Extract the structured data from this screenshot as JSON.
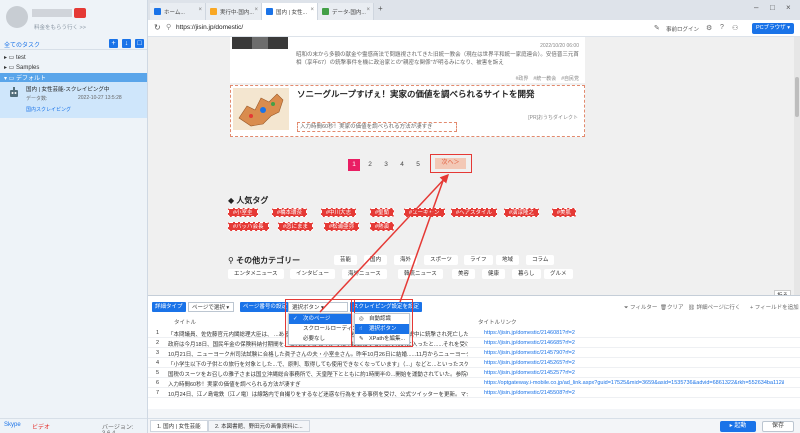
{
  "sidebar": {
    "user_sub": "料金をもらう行く >>",
    "all_tasks": "全てのタスク",
    "tree": [
      {
        "label": "test"
      },
      {
        "label": "Samples"
      },
      {
        "label": "デフォルト"
      }
    ],
    "task": {
      "title": "国内 | 女性芸能-スクレイピング中",
      "data_label": "データ数:",
      "date": "2022-10-27 13:5:28",
      "status": "国内スクレイピング"
    },
    "bottom": {
      "skype": "Skype",
      "video": "ビデオ",
      "version": "バージョン: 3.6.4"
    }
  },
  "browser": {
    "tabs": [
      {
        "label": "ホーム..."
      },
      {
        "label": "実行中-国内..."
      },
      {
        "label": "国内 | 女性..."
      },
      {
        "label": "データ-国内..."
      }
    ],
    "new_tab": "+",
    "url": "https://jisin.jp/domestic/",
    "login": "事前ログイン",
    "pc_browser": "PCブラウザ"
  },
  "web": {
    "article1": {
      "meta": "2022/10/20 06:00",
      "body": "昭和の末から多額の献金や霊感商法で問題視されてきた旧統一教会（現在は世界平和統一家庭連合）。安倍晋三元首相（享年67）の銃撃事件を機に政治家との\"親密な関係\"が明るみになり、被害を訴え",
      "tags": "#政界　#統一教会　#自民党"
    },
    "article2": {
      "title": "ソニーグループすげぇ！実家の価値を調べられるサイトを開発",
      "meta": "[PR]おうちダイレクト",
      "body": "入力時間60秒！実家の価値を調べられる方法が凄すぎ"
    },
    "pager": [
      "1",
      "2",
      "3",
      "4",
      "5"
    ],
    "next": "次へ＞",
    "popular_tags_title": "人気タグ",
    "tags": [
      "#小室圭",
      "#橋本環奈",
      "#中川大志",
      "#聖蘭",
      "#ユーキャン",
      "#ヘアスタイル",
      "#演淳隆之",
      "#美肌",
      "#バッハ会長",
      "#恋にまま",
      "#松浦亜弥",
      "#熱演"
    ],
    "categories_title": "その他カテゴリー",
    "categories_row1": [
      "芸能",
      "国内",
      "海外",
      "スポーツ",
      "ライフ",
      "地域",
      "コラム"
    ],
    "categories_row2": [
      "エンタメニュース",
      "インタビュー",
      "海外ニュース",
      "韓流ニュース",
      "美容",
      "健康",
      "暮らし",
      "グルメ"
    ]
  },
  "panel": {
    "collapse": "折る",
    "toolbar": {
      "advanced": "詳細タイプ",
      "page_type": "ページで選択",
      "page_settings": "ページ番号の設定",
      "select_button": "選択ボタン",
      "scrape_settings": "スクレイピング設定を設定",
      "filter": "フィルター",
      "clear": "クリア",
      "search_other": "詳細ページに行く",
      "add_field": "フィールドを追加"
    },
    "dropdown1": [
      "次のページ",
      "スクロールローディング",
      "必要なし"
    ],
    "dropdown2": [
      "自動認識",
      "選択ボタン",
      "XPathを編集..."
    ],
    "columns": [
      "タイトル",
      "タイトルリンク"
    ],
    "rows": [
      {
        "n": "1",
        "title": "「本問議員、佐佐藤官元内閣総理大臣は、 ...ある7月8日に...主義的で仕事を...を公民館...で選挙演説中に銃撃され死亡したことは......確かに感慨を......へ転載された。（中",
        "link": "https://jisin.jp/domestic/2146081?rf=2"
      },
      {
        "n": "2",
        "title": "政府は今月18日、国民年金の保険料納付期間を、これまでの40年から45年に延長する方向で検討に入ったと......それを受け延長を6月に決めた。これが実現",
        "link": "https://jisin.jp/domestic/2146685?rf=2"
      },
      {
        "n": "3",
        "title": "10月21日、ニューヨーク州司法試験に合格した眞子さんの夫・小室圭さん。昨年10月26日に結婚......11月からニューヨークで",
        "link": "https://jisin.jp/domestic/2145790?rf=2"
      },
      {
        "n": "4",
        "title": "「小学生以下の子供との旅行を対象とした...で、原則、取得しても使用できなくなっています」（...」などと...といったスケジュール",
        "link": "https://jisin.jp/domestic/2145265?rf=2"
      },
      {
        "n": "5",
        "title": "国税のスーツをお召しの雅子さまは国立沖縄総合事務所で、天皇陛下とともに約1時間半の...開始を運動されていた。参院のため訪問先の平和祈",
        "link": "https://jisin.jp/domestic/2145257?rf=2"
      },
      {
        "n": "6",
        "title": "入力時間60秒！実家の価値を調べられる方法が凄すぎ",
        "link": "https://optgateway.i-mobile.co.jp/ad_link.aspx?guid=17525&mid=3659&asid=1535736&advid=6861322&rkh=552634ba112&c2=wa"
      },
      {
        "n": "7",
        "title": "10月24日、江ノ島電鉄（江ノ電）は線路内で自撮りをするなど迷惑な行為をする事例を受け、公式ツイッターを更新。マナーを守るよう呼びかけた",
        "link": "https://jisin.jp/domestic/2145508?rf=2"
      }
    ],
    "bottom_tabs": [
      "1. 国内 | 女性芸能",
      "2. 本図書館、野田元の画像資料に..."
    ]
  },
  "status": {
    "run": "起動",
    "save": "保存"
  },
  "colors": {
    "accent": "#1a73e8",
    "annotation": "#e53935",
    "tag_bg": "#e53935",
    "pager_current": "#e91e63"
  }
}
